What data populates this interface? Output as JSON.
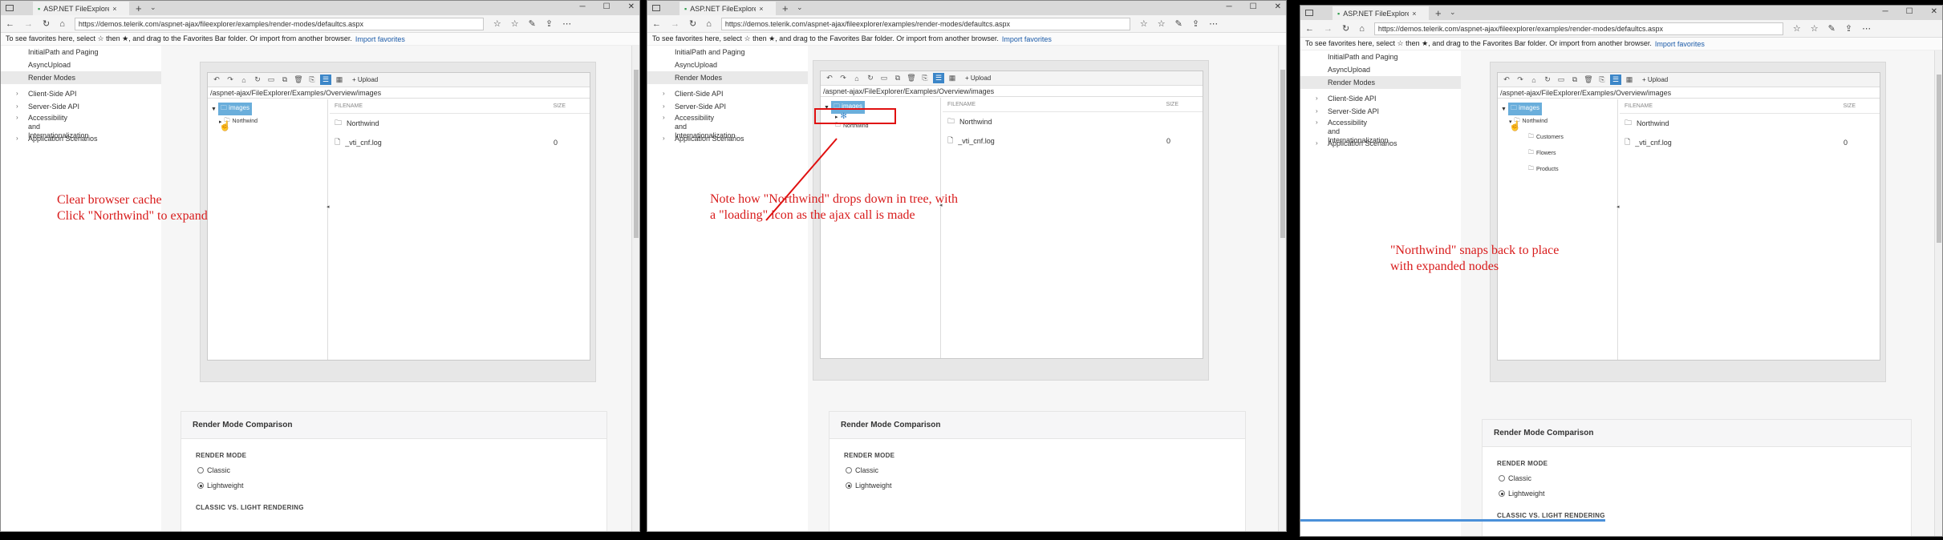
{
  "browser": {
    "tab_title": "ASP.NET FileExplorer Dc",
    "tab_close": "×",
    "new_tab": "+",
    "tab_menu": "⌄",
    "url": "https://demos.telerik.com/aspnet-ajax/fileexplorer/examples/render-modes/defaultcs.aspx",
    "favorites_hint": "To see favorites here, select ☆ then ★, and drag to the Favorites Bar folder. Or import from another browser.",
    "import_link": "Import favorites",
    "win_min": "─",
    "win_max": "☐",
    "win_close": "✕"
  },
  "sidebar": {
    "items": [
      {
        "label": "InitialPath and Paging"
      },
      {
        "label": "AsyncUpload"
      },
      {
        "label": "Render Modes"
      },
      {
        "label": "Client-Side API"
      },
      {
        "label": "Server-Side API"
      },
      {
        "label": "Accessibility and Internationalization"
      },
      {
        "label": "Application Scenarios"
      }
    ]
  },
  "explorer": {
    "upload_label": "Upload",
    "path": "/aspnet-ajax/FileExplorer/Examples/Overview/images",
    "tree_root": "images",
    "tree_child": "Northwind",
    "expanded_nodes": [
      "Customers",
      "Flowers",
      "Products"
    ],
    "col_filename": "FILENAME",
    "col_size": "SIZE",
    "rows": [
      {
        "name": "Northwind",
        "size": ""
      },
      {
        "name": "_vti_cnf.log",
        "size": "0"
      }
    ]
  },
  "comparison": {
    "title": "Render Mode Comparison",
    "render_mode_label": "RENDER MODE",
    "option_classic": "Classic",
    "option_lightweight": "Lightweight",
    "selected": "Lightweight",
    "next_section": "CLASSIC VS. LIGHT RENDERING"
  },
  "annotations": {
    "step1": "Clear browser cache\nClick \"Northwind\" to expand",
    "step2": "Note how \"Northwind\" drops down in tree, with\na \"loading\" icon as the ajax call is made",
    "step3": "\"Northwind\" snaps back to place\nwith expanded nodes"
  },
  "colors": {
    "annotation": "#d81b1b",
    "selected_node": "#6aaedb",
    "toolbar_active": "#3c86c8"
  }
}
